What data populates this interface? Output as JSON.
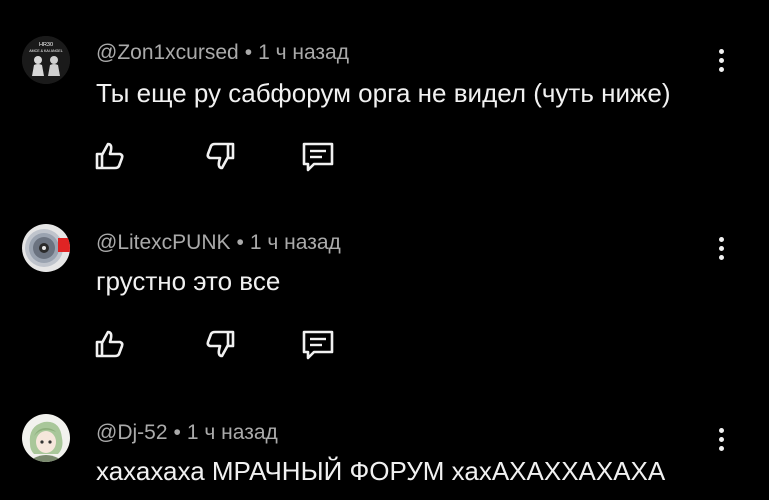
{
  "colors": {
    "background": "#000000",
    "text": "#f1f1f1",
    "meta": "#aaaaaa"
  },
  "comments": [
    {
      "author": "@Zon1xcursed",
      "separator": "•",
      "time": "1 ч назад",
      "text": "Ты еще ру сабфорум орга не видел (чуть ниже)",
      "avatar": {
        "icon": "avatar-two-figures-icon",
        "lines": [
          "HR30",
          "AMCE & KAI ANGEL"
        ]
      },
      "actions": [
        "like-icon",
        "dislike-icon",
        "reply-icon"
      ]
    },
    {
      "author": "@LitexcPUNK",
      "separator": "•",
      "time": "1 ч назад",
      "text": "грустно это все",
      "avatar": {
        "icon": "avatar-cd-disc-icon"
      },
      "actions": [
        "like-icon",
        "dislike-icon",
        "reply-icon"
      ]
    },
    {
      "author": "@Dj-52",
      "separator": "•",
      "time": "1 ч назад",
      "text": "хахахаха МРАЧНЫЙ ФОРУМ хахАХАХХАХАХА",
      "avatar": {
        "icon": "avatar-anime-character-icon"
      },
      "actions": []
    }
  ]
}
